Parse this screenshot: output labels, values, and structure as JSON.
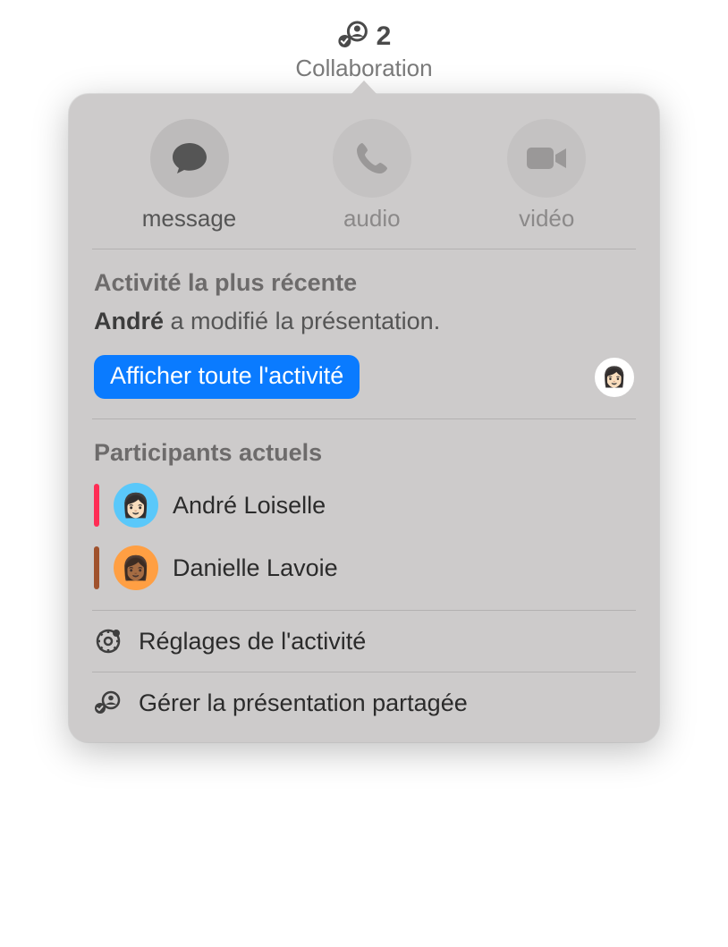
{
  "toolbar": {
    "count": "2",
    "label": "Collaboration"
  },
  "actions": {
    "message": "message",
    "audio": "audio",
    "video": "vidéo"
  },
  "activity": {
    "title": "Activité la plus récente",
    "actor": "André",
    "rest": " a modifié la présentation.",
    "show_all": "Afficher toute l'activité",
    "recent_avatar": {
      "emoji": "👩🏻",
      "bg": "#ffffff"
    }
  },
  "participants": {
    "title": "Participants actuels",
    "items": [
      {
        "name": "André Loiselle",
        "color": "#ff2d55",
        "avatar_bg": "#5ac8fa",
        "emoji": "👩🏻"
      },
      {
        "name": "Danielle Lavoie",
        "color": "#a0522d",
        "avatar_bg": "#ff9f43",
        "emoji": "👩🏾"
      }
    ]
  },
  "footer": {
    "settings": "Réglages de l'activité",
    "manage": "Gérer la présentation partagée"
  },
  "colors": {
    "accent": "#0a7bff"
  }
}
